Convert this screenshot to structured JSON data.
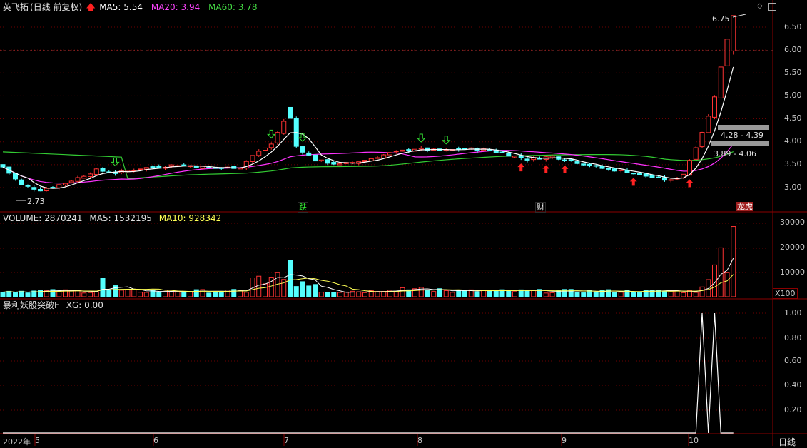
{
  "price_panel": {
    "stock_name": "英飞拓",
    "mode": "(日线 前复权)",
    "ma5_label": "MA5: 5.54",
    "ma20_label": "MA20: 3.94",
    "ma60_label": "MA60: 3.78",
    "high_label": "6.75",
    "low_label": "2.73",
    "zone_upper_label": "4.28 - 4.39",
    "zone_lower_label": "3.89 - 4.06",
    "event_labels": [
      "跌",
      "财",
      "龙虎"
    ],
    "y_ticks": [
      "6.50",
      "6.00",
      "5.50",
      "5.00",
      "4.50",
      "4.00",
      "3.50",
      "3.00"
    ]
  },
  "volume_panel": {
    "volume_label": "VOLUME: 2870241",
    "ma5_label": "MA5: 1532195",
    "ma10_label": "MA10: 928342",
    "y_ticks": [
      "30000",
      "20000",
      "10000"
    ],
    "unit": "X100"
  },
  "indicator_panel": {
    "title": "暴利妖股突破F",
    "xg_label": "XG: 0.00",
    "y_ticks": [
      "1.00",
      "0.80",
      "0.60",
      "0.40",
      "0.20"
    ]
  },
  "x_axis": {
    "year_label": "2022年",
    "months": [
      "5",
      "6",
      "7",
      "8",
      "9",
      "10"
    ]
  },
  "period_button": "日线",
  "colors": {
    "up": "#ff3333",
    "down": "#54ffff",
    "ma5": "#ffffff",
    "ma20": "#ff33ff",
    "ma60": "#33cc33",
    "grid": "#8b0000",
    "volume_ma10": "#ffff55"
  }
}
